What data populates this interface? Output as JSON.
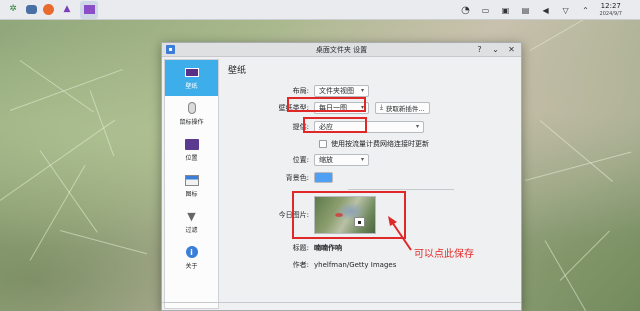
{
  "taskbar": {
    "icons": [
      "apps-menu-icon",
      "file-manager-icon",
      "firefox-icon",
      "app-icon",
      "desktop-settings-icon"
    ],
    "clock_time": "12:27",
    "clock_date": "2024/9/7"
  },
  "window": {
    "title": "桌面文件夹 设置"
  },
  "sidebar": {
    "items": [
      {
        "label": "壁纸",
        "icon": "wallpaper-icon"
      },
      {
        "label": "鼠标操作",
        "icon": "mouse-icon"
      },
      {
        "label": "位置",
        "icon": "folder-icon"
      },
      {
        "label": "图标",
        "icon": "icons-icon"
      },
      {
        "label": "过滤",
        "icon": "filter-icon"
      },
      {
        "label": "关于",
        "icon": "info-icon"
      }
    ]
  },
  "main": {
    "section_title": "壁纸",
    "layout_label": "布局:",
    "layout_value": "文件夹视图",
    "wallpaper_type_label": "壁纸类型:",
    "wallpaper_type_value": "每日一图",
    "get_plugins_label": "获取新插件...",
    "provider_label": "提供:",
    "provider_value": "必应",
    "metered_checkbox_label": "使用按流量计费网络连接时更新",
    "position_label": "位置:",
    "position_value": "缩放",
    "background_color_label": "背景色:",
    "background_color": "#4f9ff5",
    "today_image_label": "今日图片:",
    "title_label": "标题:",
    "title_value": "喃喃作响",
    "author_label": "作者:",
    "author_value": "yhelfman/Getty Images"
  },
  "annotation": {
    "text": "可以点此保存",
    "color": "#e02828"
  }
}
